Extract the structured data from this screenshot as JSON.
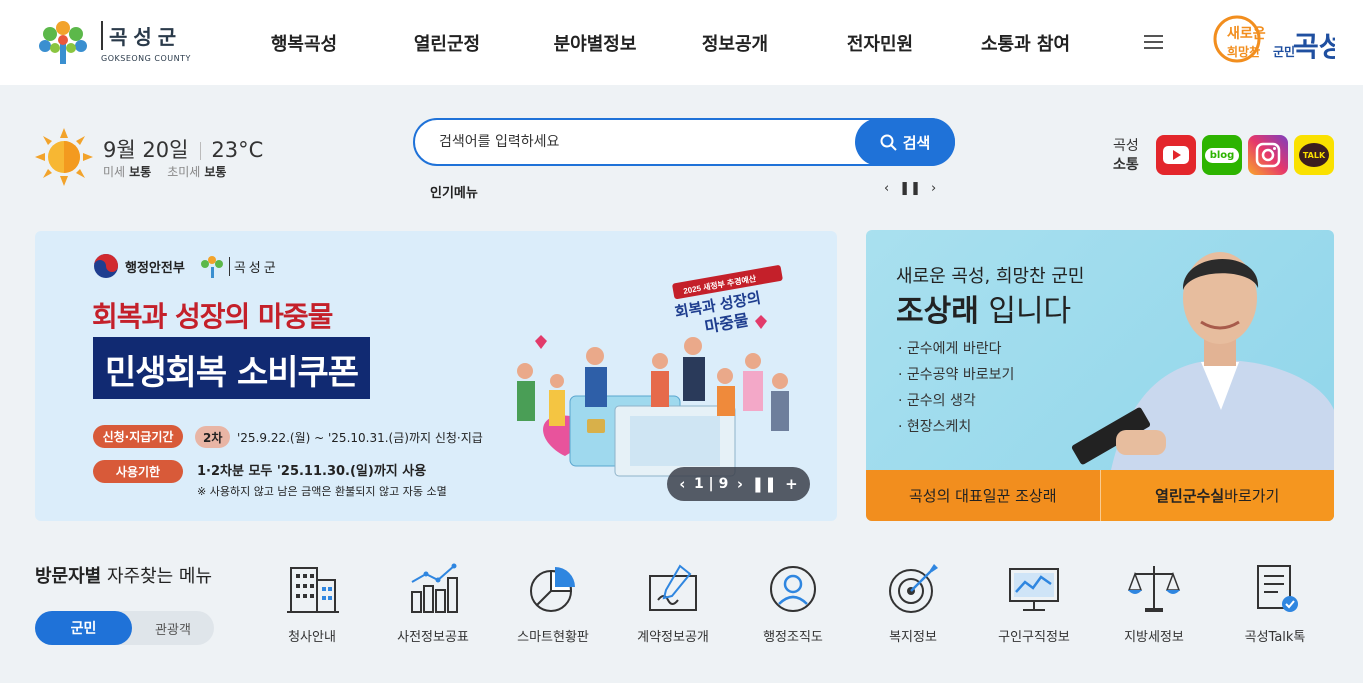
{
  "header": {
    "logo_ko": "곡성군",
    "logo_en": "GOKSEONG COUNTY",
    "nav": [
      "행복곡성",
      "열린군정",
      "분야별정보",
      "정보공개",
      "전자민원",
      "소통과 참여"
    ],
    "slogan_top": "새로운",
    "slogan_mid": "희망찬",
    "slogan_sub": "군민",
    "slogan_main": "곡성"
  },
  "weather": {
    "date": "9월 20일",
    "temp": "23°C",
    "dust_label": "미세",
    "dust_value": "보통",
    "ultra_label": "초미세",
    "ultra_value": "보통"
  },
  "search": {
    "placeholder": "검색어를 입력하세요",
    "button": "검색",
    "popular_label": "인기메뉴"
  },
  "sns": {
    "label1": "곡성",
    "label2": "소통",
    "blog": "blog",
    "kakao": "TALK"
  },
  "banner": {
    "org1": "행정안전부",
    "org2": "곡성군",
    "badge1": "2025 새정부 추경예산",
    "badge2": "회복과 성장의",
    "badge3": "마중물",
    "title1": "회복과 성장의 마중물",
    "title2": "민생회복 소비쿠폰",
    "tag1": "신청·지급기간",
    "round": "2차",
    "period": "'25.9.22.(월) ~ '25.10.31.(금)까지 신청·지급",
    "tag2": "사용기한",
    "usage": "1·2차분 모두 '25.11.30.(일)까지 사용",
    "note": "※ 사용하지 않고 남은 금액은 환불되지 않고 자동 소멸",
    "current": "1",
    "total": "9"
  },
  "mayor": {
    "subtitle": "새로운 곡성, 희망찬 군민",
    "name": "조상래",
    "name_suffix": " 입니다",
    "links": [
      "· 군수에게 바란다",
      "· 군수공약 바로보기",
      "· 군수의 생각",
      "· 현장스케치"
    ],
    "bottom_left": "곡성의 대표일꾼 조상래",
    "bottom_right_bold": "열린군수실",
    "bottom_right": " 바로가기"
  },
  "quick": {
    "title_bold": "방문자별",
    "title_rest": " 자주찾는 메뉴",
    "tab_on": "군민",
    "tab_off": "관광객",
    "items": [
      "청사안내",
      "사전정보공표",
      "스마트현황판",
      "계약정보공개",
      "행정조직도",
      "복지정보",
      "구인구직정보",
      "지방세정보",
      "곡성Talk톡"
    ]
  },
  "colors": {
    "primary": "#1f72d8",
    "navy": "#112a72",
    "orange": "#f28e1e",
    "red": "#c4202a"
  }
}
